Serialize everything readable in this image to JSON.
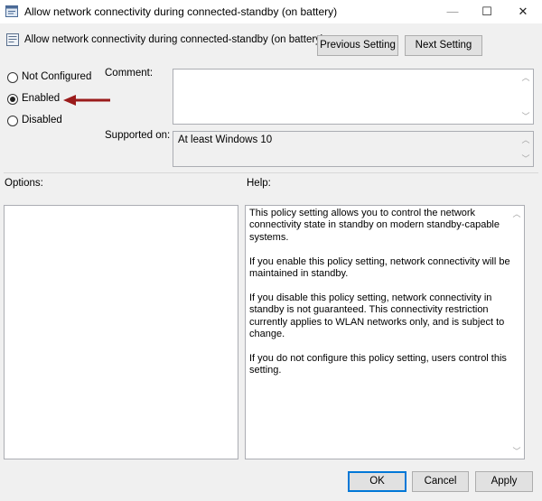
{
  "window": {
    "title": "Allow network connectivity during connected-standby (on battery)",
    "controls": {
      "minimize": "—",
      "maximize": "☐",
      "close": "✕"
    }
  },
  "header": {
    "policy_name": "Allow network connectivity during connected-standby (on battery)",
    "previous_label": "Previous Setting",
    "next_label": "Next Setting"
  },
  "state": {
    "options": [
      {
        "label": "Not Configured",
        "selected": false
      },
      {
        "label": "Enabled",
        "selected": true
      },
      {
        "label": "Disabled",
        "selected": false
      }
    ]
  },
  "comment": {
    "label": "Comment:",
    "value": ""
  },
  "supported": {
    "label": "Supported on:",
    "value": "At least Windows 10"
  },
  "options_panel": {
    "label": "Options:"
  },
  "help_panel": {
    "label": "Help:",
    "paragraphs": [
      "This policy setting allows you to control the network connectivity state in standby on modern standby-capable systems.",
      "If you enable this policy setting, network connectivity will be maintained in standby.",
      "If you disable this policy setting, network connectivity in standby is not guaranteed. This connectivity restriction currently applies to WLAN networks only, and is subject to change.",
      "If you do not configure this policy setting, users control this setting."
    ]
  },
  "footer": {
    "ok_label": "OK",
    "cancel_label": "Cancel",
    "apply_label": "Apply"
  },
  "colors": {
    "annotation_arrow": "#9b1b1b",
    "focus_border": "#0078d7"
  }
}
